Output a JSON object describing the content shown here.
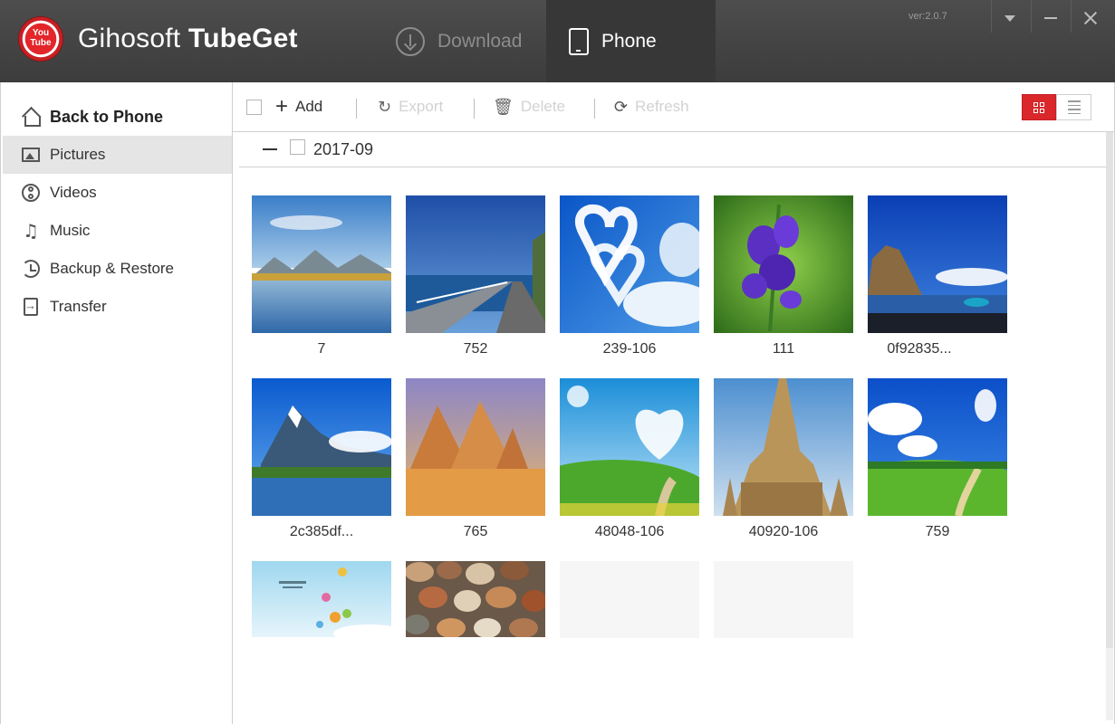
{
  "app": {
    "logo_text_line1": "You",
    "logo_text_line2": "Tube",
    "name_light": "Gihosoft",
    "name_bold": "TubeGet",
    "version": "ver:2.0.7"
  },
  "tabs": {
    "download": "Download",
    "phone": "Phone"
  },
  "sidebar": {
    "items": [
      {
        "label": "Back to Phone",
        "icon": "home-icon"
      },
      {
        "label": "Pictures",
        "icon": "picture-icon"
      },
      {
        "label": "Videos",
        "icon": "film-icon"
      },
      {
        "label": "Music",
        "icon": "music-icon"
      },
      {
        "label": "Backup & Restore",
        "icon": "backup-icon"
      },
      {
        "label": "Transfer",
        "icon": "transfer-icon"
      }
    ],
    "active": "Pictures"
  },
  "toolbar": {
    "add": "Add",
    "export": "Export",
    "delete": "Delete",
    "refresh": "Refresh",
    "view_mode": "grid"
  },
  "group": {
    "label": "2017-09"
  },
  "pictures": [
    {
      "caption": "7"
    },
    {
      "caption": "752"
    },
    {
      "caption": "239-106"
    },
    {
      "caption": "111"
    },
    {
      "caption": "0f92835..."
    },
    {
      "caption": "2c385df..."
    },
    {
      "caption": "765"
    },
    {
      "caption": "48048-106"
    },
    {
      "caption": "40920-106"
    },
    {
      "caption": "759"
    }
  ],
  "colors": {
    "header": "#444444",
    "accent": "#d9272b",
    "sidebar_active": "#e5e5e5"
  }
}
